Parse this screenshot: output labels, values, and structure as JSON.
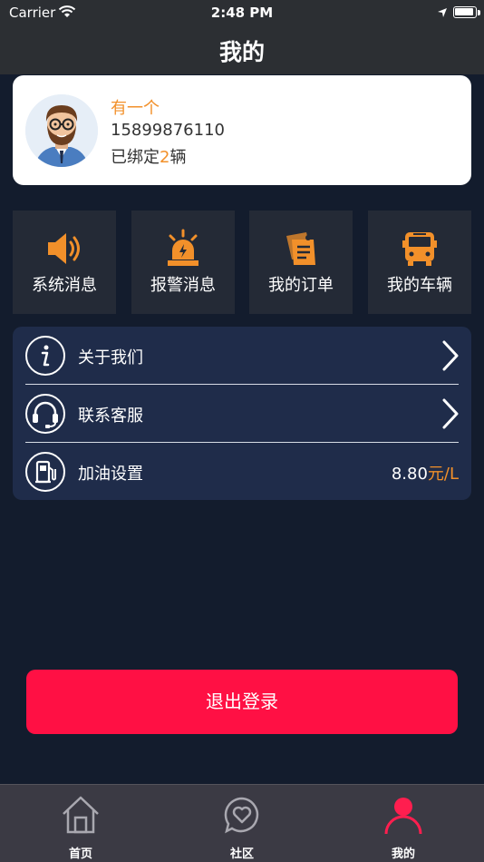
{
  "status_bar": {
    "carrier": "Carrier",
    "time": "2:48 PM"
  },
  "nav": {
    "title": "我的"
  },
  "profile": {
    "name": "有一个",
    "phone": "15899876110",
    "bound_prefix": "已绑定",
    "bound_count": "2",
    "bound_suffix": "辆"
  },
  "tiles": [
    {
      "label": "系统消息",
      "icon": "speaker-icon"
    },
    {
      "label": "报警消息",
      "icon": "alarm-siren-icon"
    },
    {
      "label": "我的订单",
      "icon": "order-notes-icon"
    },
    {
      "label": "我的车辆",
      "icon": "bus-icon"
    }
  ],
  "menu": {
    "about": {
      "label": "关于我们",
      "icon": "info-icon"
    },
    "support": {
      "label": "联系客服",
      "icon": "headset-icon"
    },
    "fuel": {
      "label": "加油设置",
      "icon": "fuel-pump-icon",
      "value": "8.80",
      "unit": "元/L"
    }
  },
  "logout_label": "退出登录",
  "tabbar": [
    {
      "label": "首页",
      "icon": "home-icon"
    },
    {
      "label": "社区",
      "icon": "heart-chat-icon"
    },
    {
      "label": "我的",
      "icon": "person-icon"
    }
  ],
  "colors": {
    "background": "#131c2d",
    "accent_orange": "#f2902a",
    "logout_red": "#ff1044",
    "active_tab": "#ff1e4f",
    "menu_bg": "#1f2c4a",
    "tile_bg": "#242a36"
  }
}
